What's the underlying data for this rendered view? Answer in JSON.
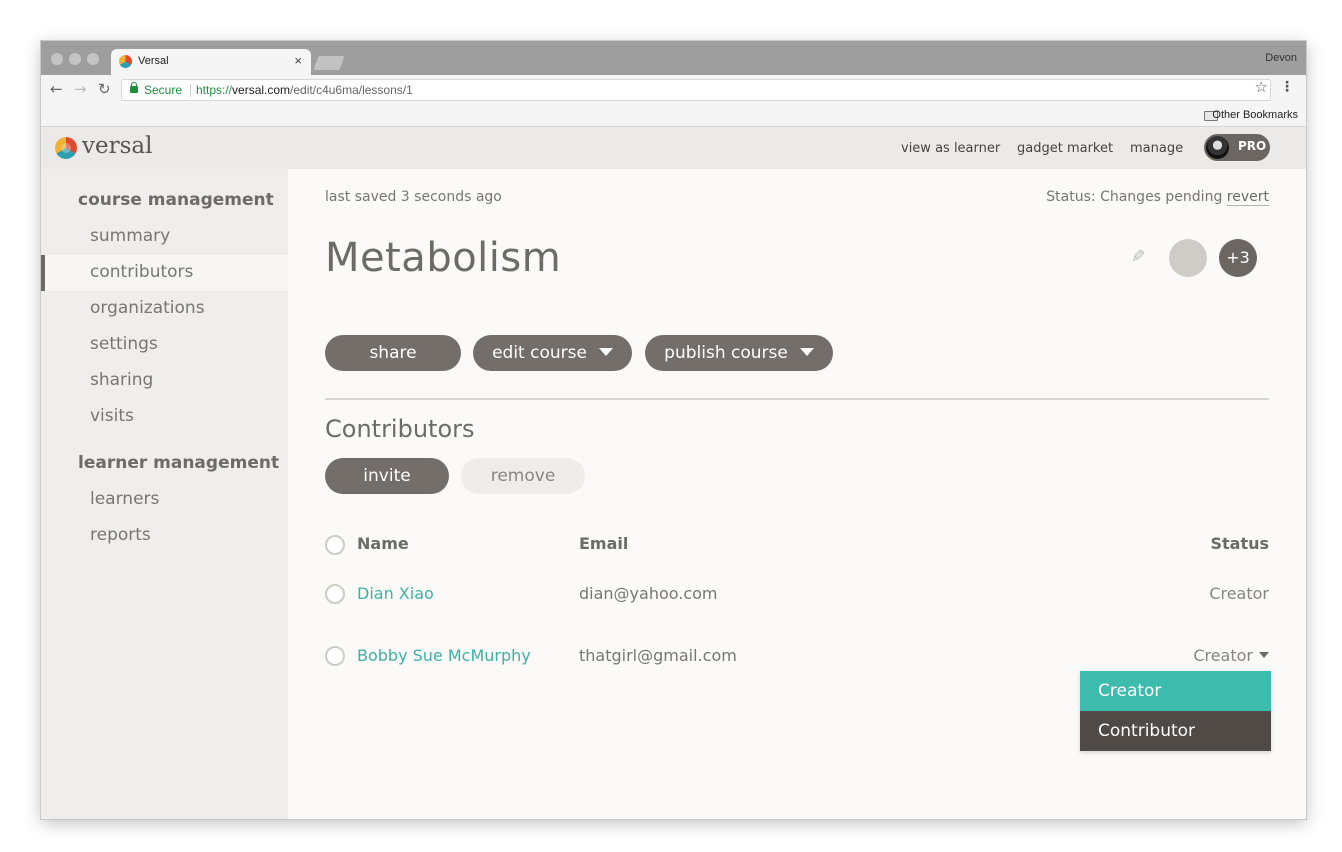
{
  "browser": {
    "tab_title": "Versal",
    "tab_close": "×",
    "profile_name": "Devon",
    "secure_label": "Secure",
    "url_scheme": "https://",
    "url_host": "versal.com",
    "url_path": "/edit/c4u6ma/lessons/1",
    "bookmarks_folder": "Other Bookmarks",
    "icons": [
      "back-icon",
      "forward-icon",
      "reload-icon",
      "lock-icon",
      "star-icon",
      "menu-icon",
      "folder-icon"
    ]
  },
  "header": {
    "logo_text": "versal",
    "links": [
      "view as learner",
      "gadget market",
      "manage"
    ],
    "pro_label": "PRO"
  },
  "sidebar": {
    "course_heading": "course management",
    "course_items": [
      "summary",
      "contributors",
      "organizations",
      "settings",
      "sharing",
      "visits"
    ],
    "active_item": "contributors",
    "learner_heading": "learner management",
    "learner_items": [
      "learners",
      "reports"
    ]
  },
  "main": {
    "last_saved": "last saved 3 seconds ago",
    "status_prefix": "Status: Changes pending ",
    "revert": "revert",
    "course_title": "Metabolism",
    "collaborators_more": "+3",
    "buttons": {
      "share": "share",
      "edit_course": "edit course",
      "publish_course": "publish course"
    },
    "section_title": "Contributors",
    "invite": "invite",
    "remove": "remove",
    "table": {
      "headers": {
        "name": "Name",
        "email": "Email",
        "status": "Status"
      },
      "rows": [
        {
          "name": "Dian Xiao",
          "email": "dian@yahoo.com",
          "status": "Creator"
        },
        {
          "name": "Bobby Sue McMurphy",
          "email": "thatgirl@gmail.com",
          "status": "Creator"
        }
      ]
    },
    "status_dropdown": {
      "options": [
        "Creator",
        "Contributor"
      ],
      "selected": "Creator"
    }
  },
  "colors": {
    "accent_teal": "#3dbbad",
    "link_teal": "#3fb0a4",
    "button_gray": "#736e69",
    "dark_option": "#4f4a45"
  }
}
